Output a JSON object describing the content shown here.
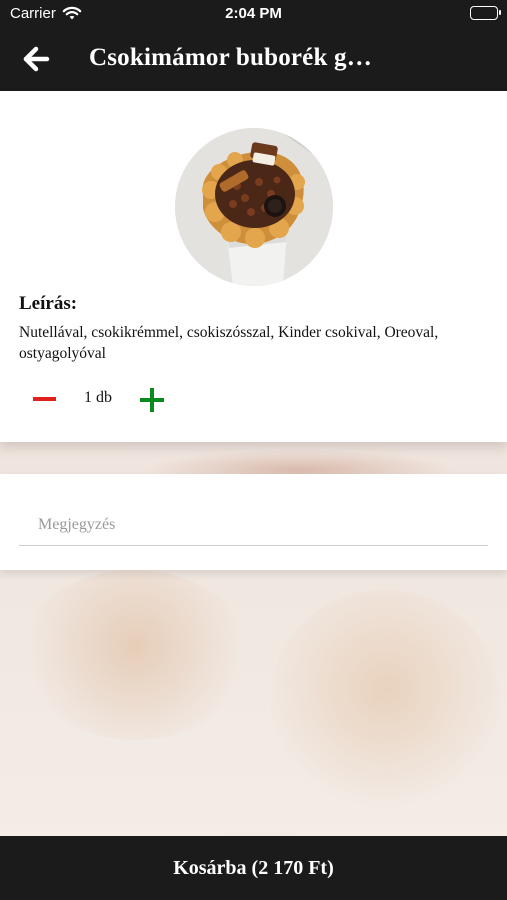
{
  "status_bar": {
    "carrier": "Carrier",
    "time": "2:04 PM",
    "icons": [
      "wifi-icon",
      "battery-icon"
    ]
  },
  "nav": {
    "back_icon": "arrow-left-icon",
    "title": "Csokimámor buborék g…"
  },
  "product": {
    "image": "bubble-waffle-photo",
    "description_heading": "Leírás:",
    "description": "Nutellával, csokikrémmel, csokiszósszal, Kinder csokival, Oreoval, ostyagolyóval",
    "quantity": "1 db",
    "minus_icon": "minus-icon",
    "plus_icon": "plus-icon"
  },
  "note": {
    "placeholder": "Megjegyzés",
    "value": ""
  },
  "cart": {
    "label": "Kosárba (2 170 Ft)"
  },
  "colors": {
    "bar_background": "#1b1b1b",
    "minus": "#e0201f",
    "plus": "#0a8a1c"
  }
}
